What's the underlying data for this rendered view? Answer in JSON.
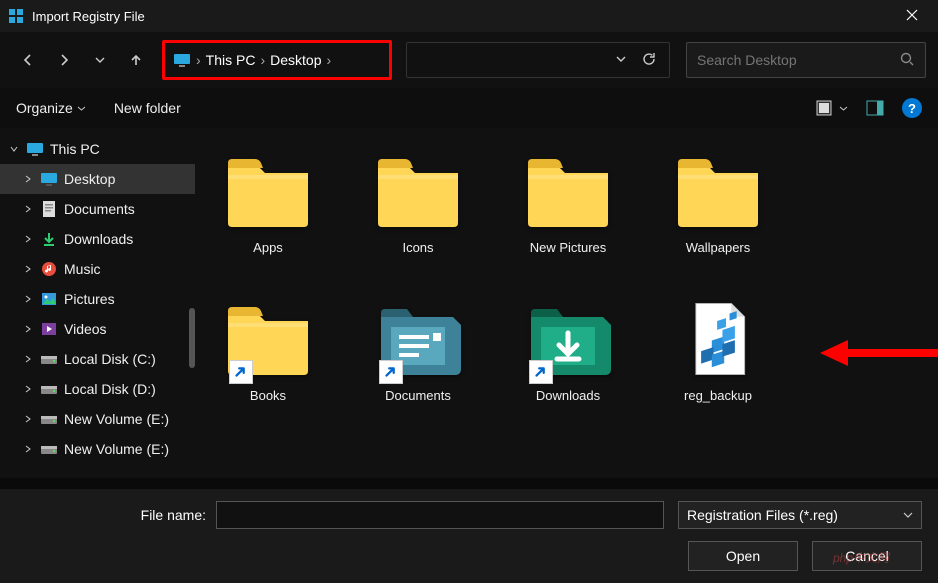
{
  "window": {
    "title": "Import Registry File"
  },
  "breadcrumb": {
    "seg1": "This PC",
    "seg2": "Desktop"
  },
  "search": {
    "placeholder": "Search Desktop"
  },
  "toolbar": {
    "organize": "Organize",
    "newfolder": "New folder"
  },
  "sidebar": {
    "items": [
      {
        "label": "This PC",
        "icon": "pc",
        "expanded": true,
        "level": 0
      },
      {
        "label": "Desktop",
        "icon": "desktop",
        "expanded": false,
        "level": 1,
        "selected": true
      },
      {
        "label": "Documents",
        "icon": "documents",
        "expanded": false,
        "level": 1
      },
      {
        "label": "Downloads",
        "icon": "downloads",
        "expanded": false,
        "level": 1
      },
      {
        "label": "Music",
        "icon": "music",
        "expanded": false,
        "level": 1
      },
      {
        "label": "Pictures",
        "icon": "pictures",
        "expanded": false,
        "level": 1
      },
      {
        "label": "Videos",
        "icon": "videos",
        "expanded": false,
        "level": 1
      },
      {
        "label": "Local Disk (C:)",
        "icon": "disk",
        "expanded": false,
        "level": 1
      },
      {
        "label": "Local Disk (D:)",
        "icon": "disk",
        "expanded": false,
        "level": 1
      },
      {
        "label": "New Volume (E:)",
        "icon": "disk",
        "expanded": false,
        "level": 1
      },
      {
        "label": "New Volume (E:)",
        "icon": "disk",
        "expanded": false,
        "level": 1
      }
    ]
  },
  "files": [
    {
      "label": "Apps",
      "type": "folder"
    },
    {
      "label": "Icons",
      "type": "folder"
    },
    {
      "label": "New Pictures",
      "type": "folder"
    },
    {
      "label": "Wallpapers",
      "type": "folder"
    },
    {
      "label": "Books",
      "type": "folder",
      "shortcut": true
    },
    {
      "label": "Documents",
      "type": "docfolder",
      "shortcut": true
    },
    {
      "label": "Downloads",
      "type": "dlfolder",
      "shortcut": true
    },
    {
      "label": "reg_backup",
      "type": "regfile"
    }
  ],
  "bottom": {
    "filename_label": "File name:",
    "filename_value": "",
    "filter_label": "Registration Files (*.reg)",
    "open": "Open",
    "cancel": "Cancel"
  }
}
